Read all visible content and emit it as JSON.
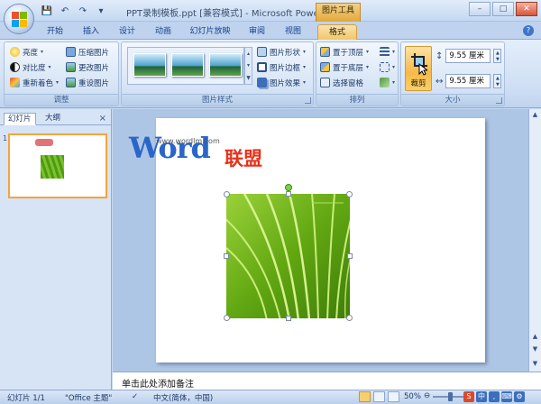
{
  "window": {
    "title": "PPT录制模板.ppt [兼容模式] - Microsoft PowerP...",
    "context_group": "图片工具"
  },
  "tabs": [
    "开始",
    "插入",
    "设计",
    "动画",
    "幻灯片放映",
    "审阅",
    "视图",
    "格式"
  ],
  "active_tab": "格式",
  "ribbon": {
    "adjust": {
      "label": "调整",
      "items": [
        "亮度",
        "对比度",
        "重新着色",
        "压缩图片",
        "更改图片",
        "重设图片"
      ]
    },
    "picture_styles": {
      "label": "图片样式",
      "items": [
        "图片形状",
        "图片边框",
        "图片效果"
      ]
    },
    "arrange": {
      "label": "排列",
      "items": [
        "置于顶层",
        "置于底层",
        "选择窗格"
      ]
    },
    "size": {
      "label": "大小",
      "crop_label": "裁剪",
      "height": "9.55 厘米",
      "width": "9.55 厘米"
    }
  },
  "pane": {
    "tab_slides": "幻灯片",
    "tab_outline": "大纲",
    "close": "×",
    "slide_number": "1"
  },
  "slide": {
    "watermark_url": "www.wordlm.com",
    "watermark_word": "Word",
    "watermark_cn": "联盟"
  },
  "notes": {
    "placeholder": "单击此处添加备注"
  },
  "status": {
    "slide_info": "幻灯片 1/1",
    "theme": "\"Office 主题\"",
    "language": "中文(简体，中国)",
    "zoom": "50%"
  },
  "colors": {
    "accent_orange": "#f7b948",
    "brand_blue": "#2a66c8",
    "brand_red": "#e8311a"
  }
}
